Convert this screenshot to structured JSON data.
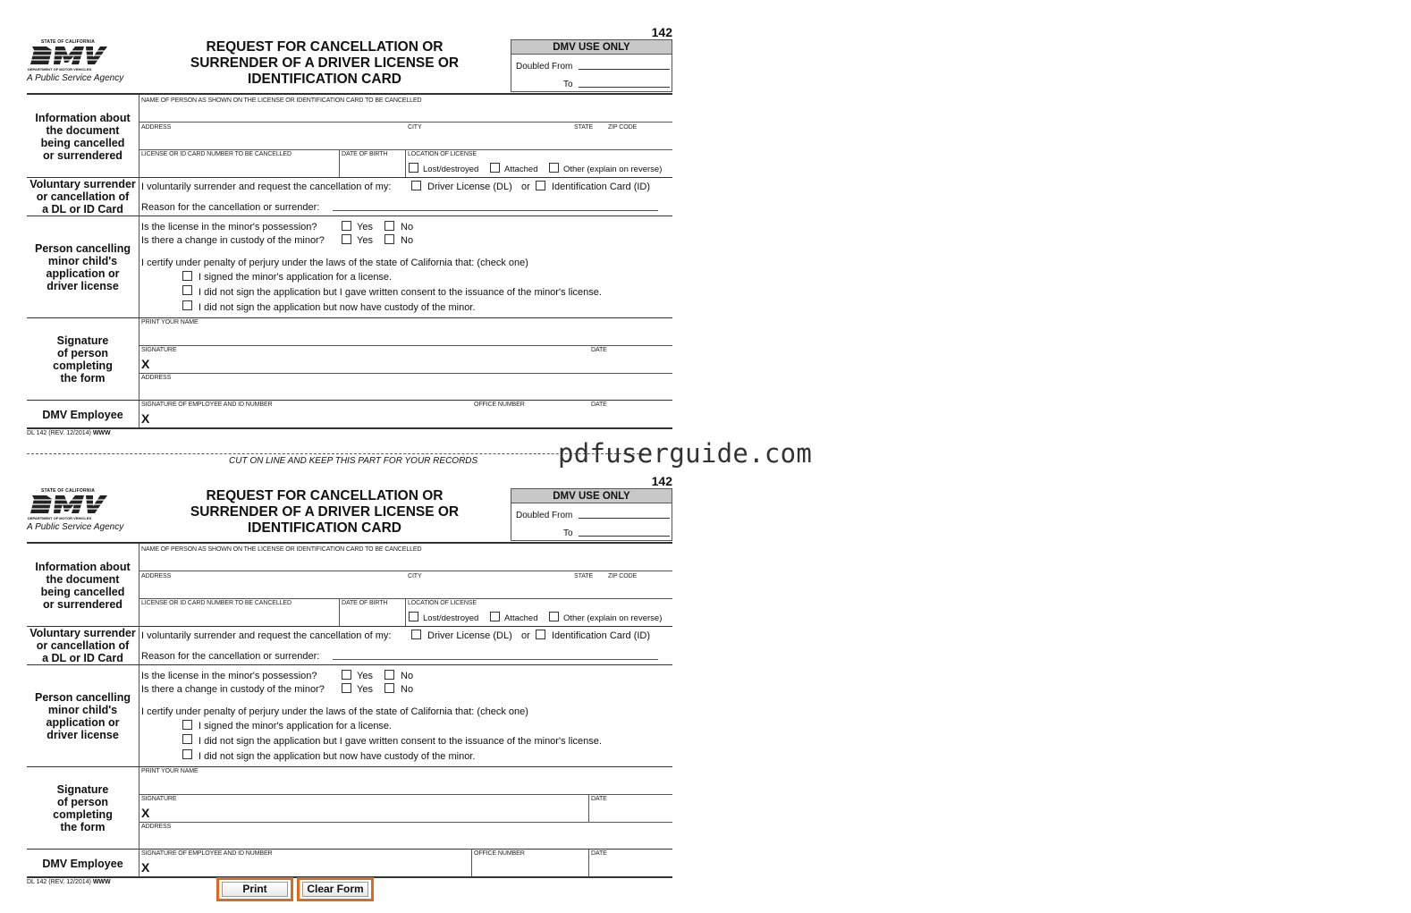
{
  "form": {
    "number": "142",
    "logo_state": "STATE OF CALIFORNIA",
    "logo_mark": "DMV",
    "logo_dept": "DEPARTMENT OF MOTOR VEHICLES",
    "agency": "A Public Service Agency",
    "title_line1": "REQUEST FOR CANCELLATION OR",
    "title_line2": "SURRENDER OF A DRIVER LICENSE OR",
    "title_line3": "IDENTIFICATION CARD",
    "dmv_use_only": "DMV USE ONLY",
    "doubled_from": "Doubled From",
    "to": "To",
    "sections": {
      "info": [
        "Information about",
        "the document",
        "being cancelled",
        "or surrendered"
      ],
      "voluntary": [
        "Voluntary surrender",
        "or cancellation of",
        "a DL or ID Card"
      ],
      "minor": [
        "Person cancelling",
        "minor child's",
        "application or",
        "driver license"
      ],
      "signature": [
        "Signature",
        "of person",
        "completing",
        "the form"
      ],
      "employee": "DMV Employee"
    },
    "labels": {
      "name": "NAME OF PERSON AS SHOWN ON THE LICENSE OR IDENTIFICATION CARD TO BE CANCELLED",
      "address": "ADDRESS",
      "city": "CITY",
      "state": "STATE",
      "zip": "ZIP CODE",
      "license_number": "LICENSE OR ID CARD NUMBER TO BE CANCELLED",
      "dob": "DATE OF BIRTH",
      "location": "LOCATION OF LICENSE",
      "lost": "Lost/destroyed",
      "attached": "Attached",
      "other": "Other (explain on reverse)",
      "voluntary_text": "I voluntarily surrender and request the cancellation of my:",
      "dl": "Driver License (DL)",
      "or": "or",
      "id": "Identification Card (ID)",
      "reason": "Reason for the cancellation or surrender:",
      "possession": "Is the license in the minor's possession?",
      "custody_change": "Is there a change in custody of the minor?",
      "yes": "Yes",
      "no": "No",
      "certify": "I certify under penalty of perjury under the laws of the state of California that: (check one)",
      "opt1": "I signed the minor's application for a license.",
      "opt2": "I did not sign the application but I gave written consent to the issuance of the minor's license.",
      "opt3": "I did not sign the application but now have custody of the minor.",
      "print_name": "PRINT YOUR NAME",
      "signature": "SIGNATURE",
      "date": "DATE",
      "x": "X",
      "employee_sig": "SIGNATURE OF EMPLOYEE AND ID NUMBER",
      "office": "OFFICE NUMBER"
    },
    "revision": "DL 142 (REV. 12/2014)",
    "revision_www": "WWW"
  },
  "cut_line": "CUT ON LINE AND KEEP THIS PART FOR YOUR RECORDS",
  "watermark": "pdfuserguide.com",
  "buttons": {
    "print": "Print",
    "clear": "Clear Form"
  },
  "colors": {
    "button_border": "#e06a1a",
    "dmv_header_bg": "#c8c8c8"
  }
}
